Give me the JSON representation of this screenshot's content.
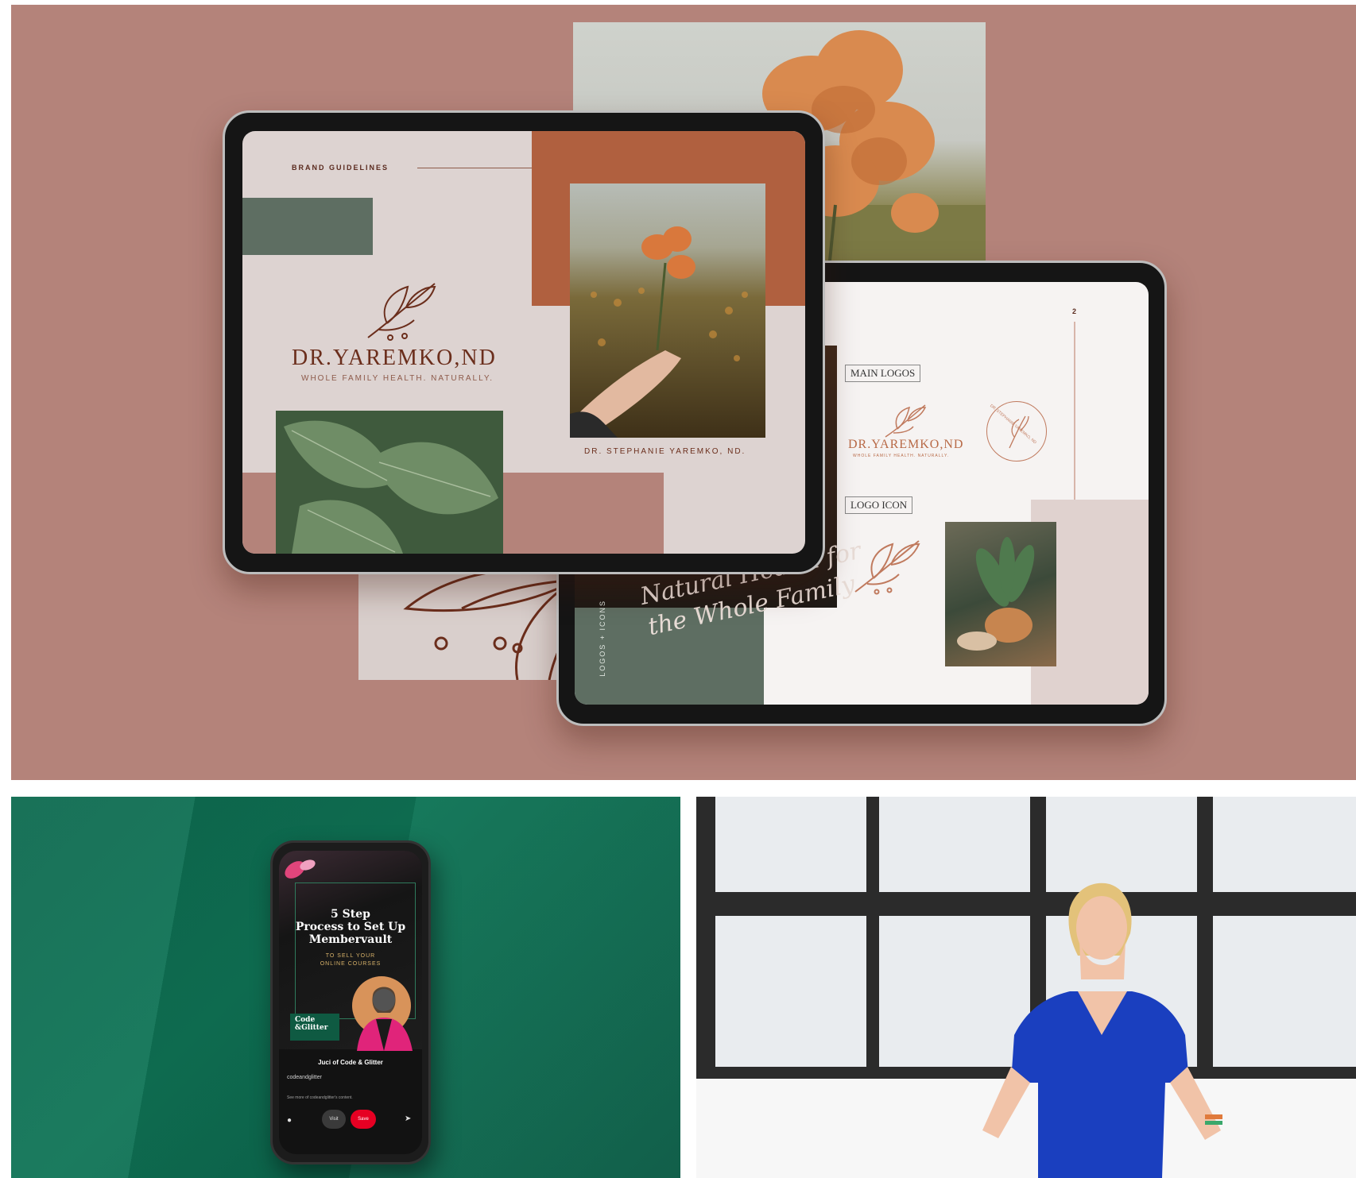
{
  "brand_board": {
    "header": "BRAND GUIDELINES",
    "logo_name": "DR.YAREMKO,ND",
    "tagline": "WHOLE FAMILY HEALTH. NATURALLY.",
    "caption": "DR. STEPHANIE YAREMKO, ND.",
    "page_number": "2",
    "main_logos_label": "MAIN LOGOS",
    "logo_icon_label": "LOGO ICON",
    "secondary_logo_name": "DR.YAREMKO,ND",
    "secondary_tagline": "WHOLE FAMILY HEALTH. NATURALLY.",
    "badge_text": "DR. STEPHANIE YAREMKO, ND",
    "side_label": "LOGOS + ICONS",
    "script_text_1": "Natural Health for",
    "script_text_2": "the Whole Family"
  },
  "phone": {
    "title_line_1": "5 Step",
    "title_line_2": "Process to Set Up",
    "title_line_3": "Membervault",
    "subtitle_line_1": "TO SELL YOUR",
    "subtitle_line_2": "ONLINE COURSES",
    "brand_line_1": "Code",
    "brand_line_2": "&Glitter",
    "pin_author": "Juci of Code & Glitter",
    "pin_username": "codeandglitter",
    "pin_more": "See more of codeandglitter's content.",
    "visit_label": "Visit",
    "save_label": "Save"
  },
  "colors": {
    "terracotta": "#b4837a",
    "rust": "#b0603f",
    "sage": "#5e6e62",
    "green_bg": "#0f7456",
    "save_red": "#e60023"
  }
}
